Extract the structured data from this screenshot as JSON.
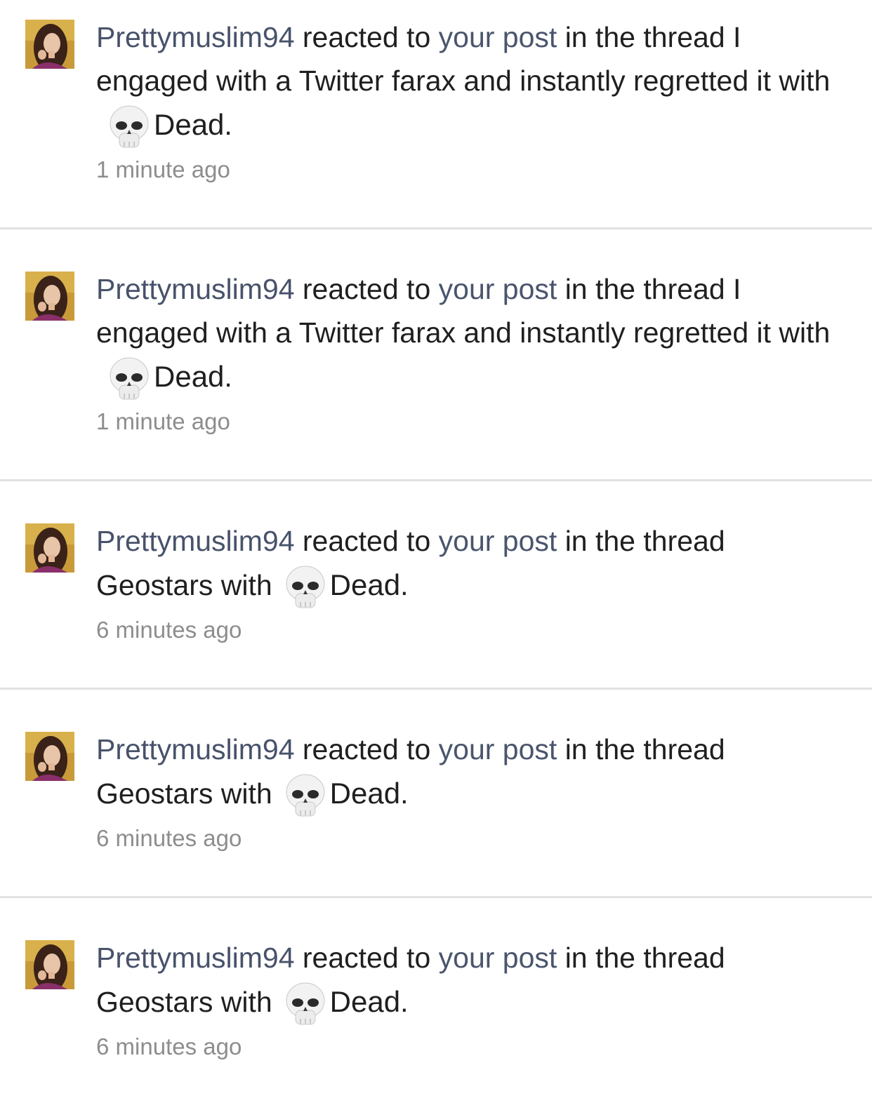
{
  "alerts": [
    {
      "username": "Prettymuslim94",
      "action": " reacted to ",
      "post_link": "your post",
      "thread_prefix": " in the thread ",
      "thread_title": "I engaged with a Twitter farax and instantly regretted it",
      "with_text": " with",
      "reaction": "Dead",
      "reaction_icon": "skull-icon",
      "period": ".",
      "time": "1 minute ago"
    },
    {
      "username": "Prettymuslim94",
      "action": " reacted to ",
      "post_link": "your post",
      "thread_prefix": " in the thread ",
      "thread_title": "I engaged with a Twitter farax and instantly regretted it",
      "with_text": " with",
      "reaction": "Dead",
      "reaction_icon": "skull-icon",
      "period": ".",
      "time": "1 minute ago"
    },
    {
      "username": "Prettymuslim94",
      "action": " reacted to ",
      "post_link": "your post",
      "thread_prefix": " in the thread ",
      "thread_title": "Geostars",
      "with_text": " with",
      "reaction": "Dead",
      "reaction_icon": "skull-icon",
      "period": ".",
      "time": "6 minutes ago"
    },
    {
      "username": "Prettymuslim94",
      "action": " reacted to ",
      "post_link": "your post",
      "thread_prefix": " in the thread ",
      "thread_title": "Geostars",
      "with_text": " with",
      "reaction": "Dead",
      "reaction_icon": "skull-icon",
      "period": ".",
      "time": "6 minutes ago"
    },
    {
      "username": "Prettymuslim94",
      "action": " reacted to ",
      "post_link": "your post",
      "thread_prefix": " in the thread ",
      "thread_title": "Geostars",
      "with_text": " with",
      "reaction": "Dead",
      "reaction_icon": "skull-icon",
      "period": ".",
      "time": "6 minutes ago"
    }
  ],
  "colors": {
    "link": "#48526b",
    "text": "#1f1f1f",
    "timestamp": "#8d8d8d",
    "divider": "#e2e2e2"
  }
}
